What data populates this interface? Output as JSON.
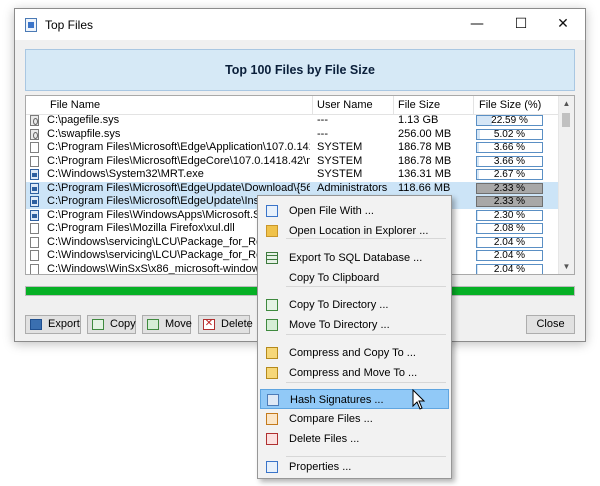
{
  "window": {
    "title": "Top Files"
  },
  "header": {
    "title": "Top 100 Files by File Size"
  },
  "columns": [
    "File Name",
    "User Name",
    "File Size",
    "File Size (%)"
  ],
  "rows": [
    {
      "name": "C:\\pagefile.sys",
      "user": "---",
      "size": "1.13 GB",
      "pct": "22.59 %",
      "frac": 0.2259,
      "icon": "system-file-icon",
      "selected": false
    },
    {
      "name": "C:\\swapfile.sys",
      "user": "---",
      "size": "256.00 MB",
      "pct": "5.02 %",
      "frac": 0.0502,
      "icon": "system-file-icon",
      "selected": false
    },
    {
      "name": "C:\\Program Files\\Microsoft\\Edge\\Application\\107.0.1418....",
      "user": "SYSTEM",
      "size": "186.78 MB",
      "pct": "3.66 %",
      "frac": 0.0366,
      "icon": "file-icon",
      "selected": false
    },
    {
      "name": "C:\\Program Files\\Microsoft\\EdgeCore\\107.0.1418.42\\mse...",
      "user": "SYSTEM",
      "size": "186.78 MB",
      "pct": "3.66 %",
      "frac": 0.0366,
      "icon": "file-icon",
      "selected": false
    },
    {
      "name": "C:\\Windows\\System32\\MRT.exe",
      "user": "SYSTEM",
      "size": "136.31 MB",
      "pct": "2.67 %",
      "frac": 0.0267,
      "icon": "exe-file-icon",
      "selected": false
    },
    {
      "name": "C:\\Program Files\\Microsoft\\EdgeUpdate\\Download\\{56E...",
      "user": "Administrators",
      "size": "118.66 MB",
      "pct": "2.33 %",
      "frac": 0.0233,
      "icon": "exe-file-icon",
      "selected": true
    },
    {
      "name": "C:\\Program Files\\Microsoft\\EdgeUpdate\\Install\\",
      "user": "",
      "size": "",
      "pct": "2.33 %",
      "frac": 0.0233,
      "icon": "exe-file-icon",
      "selected": true
    },
    {
      "name": "C:\\Program Files\\WindowsApps\\Microsoft.Skyp",
      "user": "",
      "size": "",
      "pct": "2.30 %",
      "frac": 0.023,
      "icon": "exe-file-icon",
      "selected": false
    },
    {
      "name": "C:\\Program Files\\Mozilla Firefox\\xul.dll",
      "user": "",
      "size": "",
      "pct": "2.08 %",
      "frac": 0.0208,
      "icon": "dll-file-icon",
      "selected": false
    },
    {
      "name": "C:\\Windows\\servicing\\LCU\\Package_for_Rollup",
      "user": "",
      "size": "",
      "pct": "2.04 %",
      "frac": 0.0204,
      "icon": "file-icon",
      "selected": false
    },
    {
      "name": "C:\\Windows\\servicing\\LCU\\Package_for_Rollup",
      "user": "",
      "size": "",
      "pct": "2.04 %",
      "frac": 0.0204,
      "icon": "file-icon",
      "selected": false
    },
    {
      "name": "C:\\Windows\\WinSxS\\x86_microsoft-windows-e",
      "user": "",
      "size": "",
      "pct": "2.04 %",
      "frac": 0.0204,
      "icon": "file-icon",
      "selected": false
    }
  ],
  "progress": {
    "value": 1.0,
    "color": "#06b025"
  },
  "buttons": {
    "export": "Export",
    "copy": "Copy",
    "move": "Move",
    "delete": "Delete",
    "close": "Close"
  },
  "context_menu": {
    "items": [
      {
        "label": "Open File With ...",
        "icon": "open-with-icon"
      },
      {
        "label": "Open Location in Explorer ...",
        "icon": "folder-icon"
      },
      {
        "label": "Export To SQL Database ...",
        "icon": "database-icon"
      },
      {
        "label": "Copy To Clipboard",
        "icon": ""
      },
      {
        "label": "Copy To Directory ...",
        "icon": "copy-icon"
      },
      {
        "label": "Move To Directory ...",
        "icon": "move-icon"
      },
      {
        "label": "Compress and Copy To ...",
        "icon": "compress-copy-icon"
      },
      {
        "label": "Compress and Move To ...",
        "icon": "compress-move-icon"
      },
      {
        "label": "Hash Signatures ...",
        "icon": "hash-icon"
      },
      {
        "label": "Compare Files ...",
        "icon": "compare-icon"
      },
      {
        "label": "Delete Files ...",
        "icon": "delete-icon"
      },
      {
        "label": "Properties ...",
        "icon": "properties-icon"
      }
    ],
    "highlighted": 8
  },
  "colors": {
    "accent": "#91c9f7",
    "selection": "#cce4f7",
    "header_panel": "#d6e9f6"
  }
}
